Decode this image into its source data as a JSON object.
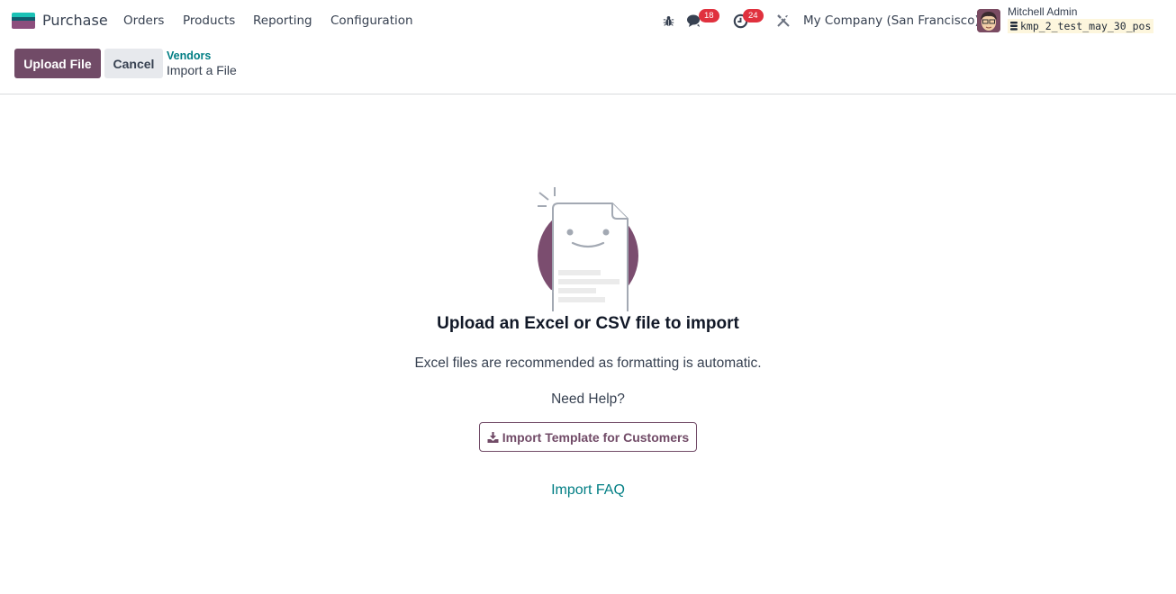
{
  "navbar": {
    "app_name": "Purchase",
    "menu": [
      {
        "label": "Orders"
      },
      {
        "label": "Products"
      },
      {
        "label": "Reporting"
      },
      {
        "label": "Configuration"
      }
    ],
    "icons": {
      "debug": "bug-icon",
      "messages": "chat-icon",
      "activities": "clock-icon",
      "settings": "tools-icon"
    },
    "messages_count": "18",
    "activities_count": "24",
    "company": "My Company (San Francisco)",
    "user_name": "Mitchell Admin",
    "database": "kmp_2_test_may_30_pos"
  },
  "control_panel": {
    "upload_label": "Upload File",
    "cancel_label": "Cancel",
    "breadcrumb_parent": "Vendors",
    "breadcrumb_current": "Import a File"
  },
  "main": {
    "title": "Upload an Excel or CSV file to import",
    "subtitle": "Excel files are recommended as formatting is automatic.",
    "help_text": "Need Help?",
    "template_button": "Import Template for Customers",
    "faq_link": "Import FAQ"
  },
  "colors": {
    "brand": "#714b67",
    "link": "#017e84",
    "badge": "#e0313e"
  }
}
